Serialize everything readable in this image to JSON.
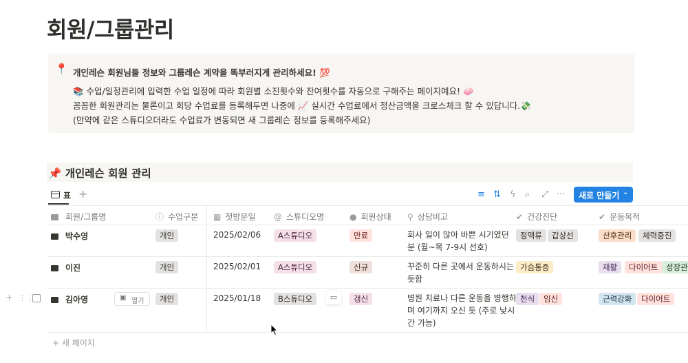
{
  "page": {
    "title": "회원/그룹관리"
  },
  "callout": {
    "icon": "📍",
    "line1": "개인레슨 회원님들 정보와 그룹레슨 계약을 똑부러지게 관리하세요! 💯",
    "line2": "📚 수업/일정관리에 입력한 수업 일정에 따라 회원별 소진횟수와 잔여횟수를 자동으로 구해주는 페이지예요! 🧼",
    "line3": "꼼꼼한 회원관리는 물론이고 회당 수업료를 등록해두면 나중에 📈 실시간 수업료에서 정산금액을 크로스체크 할 수 있답니다.💸",
    "line4": "(만약에 같은 스튜디오더라도 수업료가 변동되면 새 그룹레슨 정보를 등록해주세요)"
  },
  "section": {
    "icon": "📌",
    "title": "개인레슨 회원 관리"
  },
  "view": {
    "tab_label": "표",
    "add_symbol": "+",
    "new_button": "새로 만들기",
    "new_chevron": "⌄"
  },
  "toolbar": {
    "filter_icon": "≡",
    "sort_icon": "⇅",
    "automation_icon": "ϟ",
    "search_icon": "⌕",
    "expand_icon": "⤢",
    "more_icon": "···"
  },
  "columns": [
    {
      "label": "회원/그룹명",
      "icon": "bag-icon"
    },
    {
      "label": "수업구분",
      "icon": "info-icon"
    },
    {
      "label": "첫방문일",
      "icon": "calendar-icon"
    },
    {
      "label": "스튜디오명",
      "icon": "at-icon"
    },
    {
      "label": "회원상태",
      "icon": "status-icon"
    },
    {
      "label": "상담비고",
      "icon": "pin-icon"
    },
    {
      "label": "건강진단",
      "icon": "check-circle-icon"
    },
    {
      "label": "운동목적",
      "icon": "check-circle-icon"
    }
  ],
  "rows": [
    {
      "name": "박수영",
      "type": "개인",
      "date": "2025/02/06",
      "studio": "A스튜디오",
      "status": "만료",
      "memo": [
        "회사 일이 많아 바쁜 시기였던",
        "분 (월~목 7-9시 선호)"
      ],
      "health": [
        "정맥류",
        "갑상선"
      ],
      "goals": [
        "산후관리",
        "체력증진"
      ]
    },
    {
      "name": "이진",
      "type": "개인",
      "date": "2025/02/01",
      "studio": "A스튜디오",
      "status": "신규",
      "memo": [
        "꾸준히 다른 곳에서 운동하시는",
        "듯함"
      ],
      "health": [
        "가슴통증"
      ],
      "goals": [
        "재활",
        "다이어트",
        "성장관"
      ]
    },
    {
      "name": "김아영",
      "type": "개인",
      "date": "2025/01/18",
      "studio": "B스튜디오",
      "status": "갱신",
      "memo": [
        "병원 치료나 다른 운동을 병행하",
        "며 여기까지 오신 듯 (주로 낮시",
        "간 가능)"
      ],
      "health": [
        "천식",
        "임신"
      ],
      "goals": [
        "근력강화",
        "다이어트"
      ]
    }
  ],
  "row_actions": {
    "add": "+",
    "drag": "⋮⋮",
    "open_label": "열기"
  },
  "new_page": "+ 새 페이지"
}
